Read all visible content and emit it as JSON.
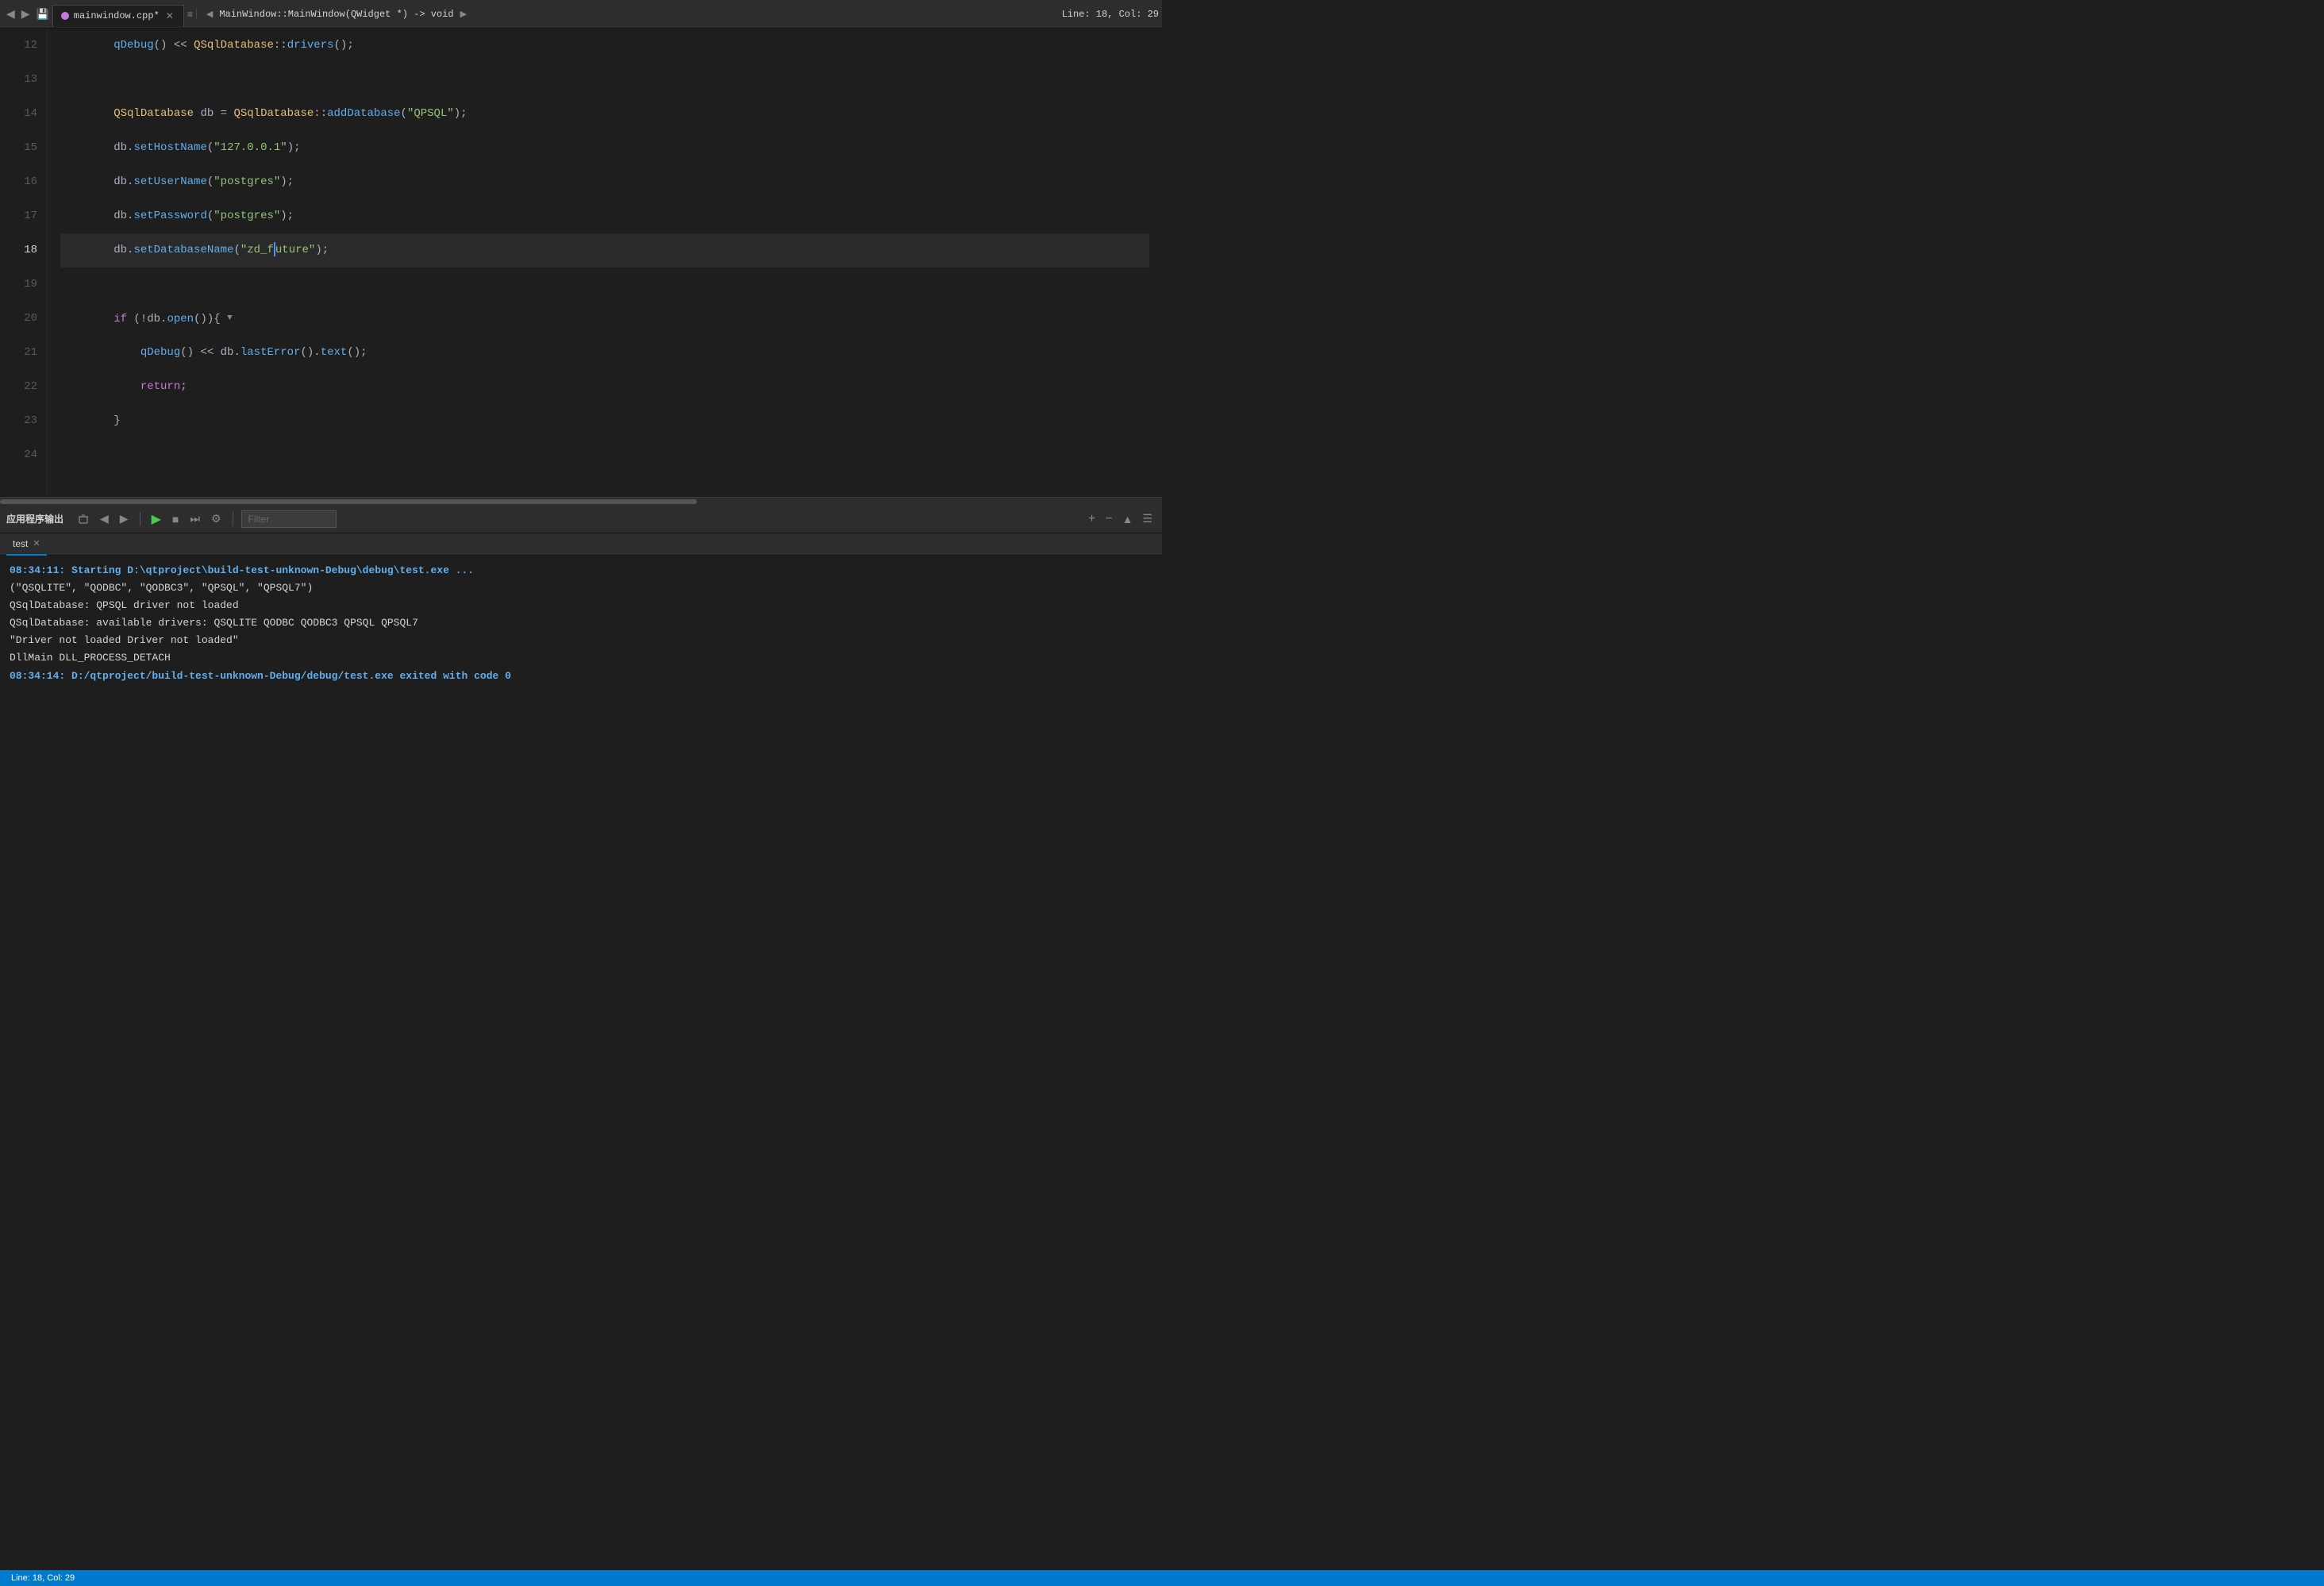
{
  "tab": {
    "filename": "mainwindow.cpp*",
    "function_nav": "MainWindow::MainWindow(QWidget *) -> void",
    "position": "Line: 18, Col: 29"
  },
  "editor": {
    "lines": [
      {
        "num": 12,
        "active": false,
        "marker": false,
        "content": "qDebug_line"
      },
      {
        "num": 13,
        "active": false,
        "marker": false,
        "content": "empty"
      },
      {
        "num": 14,
        "active": false,
        "marker": false,
        "content": "qsql_adddb"
      },
      {
        "num": 15,
        "active": false,
        "marker": false,
        "content": "set_hostname"
      },
      {
        "num": 16,
        "active": false,
        "marker": false,
        "content": "set_username"
      },
      {
        "num": 17,
        "active": false,
        "marker": false,
        "content": "set_password"
      },
      {
        "num": 18,
        "active": true,
        "marker": true,
        "content": "set_dbname"
      },
      {
        "num": 19,
        "active": false,
        "marker": false,
        "content": "empty"
      },
      {
        "num": 20,
        "active": false,
        "marker": false,
        "content": "if_open"
      },
      {
        "num": 21,
        "active": false,
        "marker": false,
        "content": "qdebug_err"
      },
      {
        "num": 22,
        "active": false,
        "marker": false,
        "content": "return"
      },
      {
        "num": 23,
        "active": false,
        "marker": false,
        "content": "close_brace"
      },
      {
        "num": 24,
        "active": false,
        "marker": false,
        "content": "empty"
      }
    ]
  },
  "bottom_panel": {
    "title": "应用程序输出",
    "tab_name": "test",
    "filter_placeholder": "Filter",
    "output_lines": [
      {
        "type": "highlight",
        "text": "08:34:11: Starting D:\\qtproject\\build-test-unknown-Debug\\debug\\test.exe ..."
      },
      {
        "type": "normal",
        "text": "(\"QSQLITE\", \"QODBC\", \"QODBC3\", \"QPSQL\", \"QPSQL7\")"
      },
      {
        "type": "normal",
        "text": "QSqlDatabase: QPSQL driver not loaded"
      },
      {
        "type": "normal",
        "text": "QSqlDatabase: available drivers: QSQLITE QODBC QODBC3 QPSQL QPSQL7"
      },
      {
        "type": "normal",
        "text": "\"Driver not loaded Driver not loaded\""
      },
      {
        "type": "normal",
        "text": "DllMain DLL_PROCESS_DETACH"
      },
      {
        "type": "highlight",
        "text": "08:34:14: D:/qtproject/build-test-unknown-Debug/debug/test.exe exited with code 0"
      }
    ]
  },
  "status_bar": {
    "position": "Line: 18, Col: 29"
  },
  "buttons": {
    "back": "◀",
    "forward": "▶",
    "save": "💾",
    "close": "✕",
    "more": "≡",
    "run": "▶",
    "stop": "■",
    "step": "⏭",
    "settings": "⚙",
    "plus": "+",
    "minus": "−",
    "maximize": "▲",
    "menu": "☰",
    "prev_nav": "◀",
    "next_nav": "▶"
  }
}
